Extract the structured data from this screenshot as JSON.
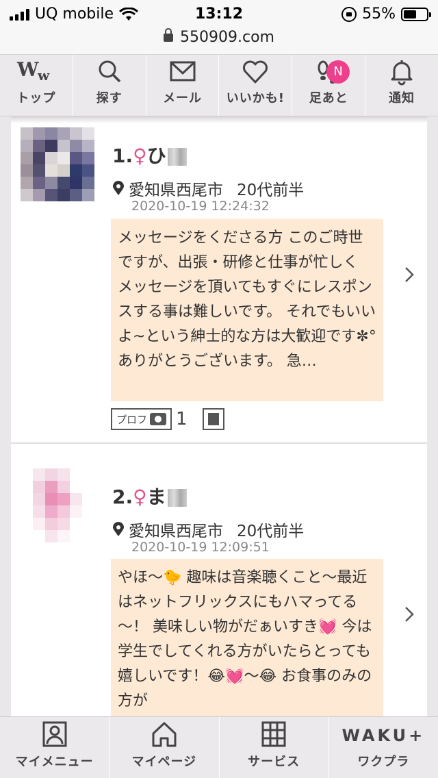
{
  "status_bar": {
    "carrier": "UQ mobile",
    "time": "13:12",
    "battery_percent": "55%",
    "battery_level": 0.55
  },
  "url_bar": {
    "url": "550909.com"
  },
  "top_nav": [
    {
      "label": "トップ",
      "icon": "ww-logo-icon"
    },
    {
      "label": "探す",
      "icon": "search-icon"
    },
    {
      "label": "メール",
      "icon": "mail-icon"
    },
    {
      "label": "いいかも!",
      "icon": "heart-icon"
    },
    {
      "label": "足あと",
      "icon": "footprints-icon",
      "badge": "N"
    },
    {
      "label": "通知",
      "icon": "bell-icon"
    }
  ],
  "posts": [
    {
      "rank": "1.",
      "gender_symbol": "♀",
      "name": "ひ",
      "location": "愛知県西尾市",
      "age": "20代前半",
      "timestamp": "2020-10-19 12:24:32",
      "message": "メッセージをくださる方 このご時世ですが、出張・研修と仕事が忙しく メッセージを頂いてもすぐにレスポンスする事は難しいです。 それでもいいよ~という紳士的な方は大歓迎です✼°ありがとうございます。 急…",
      "profile_label": "プロフ",
      "photo_count": "1"
    },
    {
      "rank": "2.",
      "gender_symbol": "♀",
      "name": "ま",
      "location": "愛知県西尾市",
      "age": "20代前半",
      "timestamp": "2020-10-19 12:09:51",
      "message": "やほ～🐤 趣味は音楽聴くこと～最近はネットフリックスにもハマってる～！ 美味しい物がだぁいすき💓 今は学生でしてくれる方がいたらとっても嬉しいです！😂💓～😂 お食事のみの方が"
    }
  ],
  "bottom_nav": [
    {
      "label": "マイメニュー",
      "icon": "profile-card-icon"
    },
    {
      "label": "マイページ",
      "icon": "home-icon"
    },
    {
      "label": "サービス",
      "icon": "grid-icon"
    },
    {
      "label": "ワクプラ",
      "logo": "WAKU+"
    }
  ]
}
